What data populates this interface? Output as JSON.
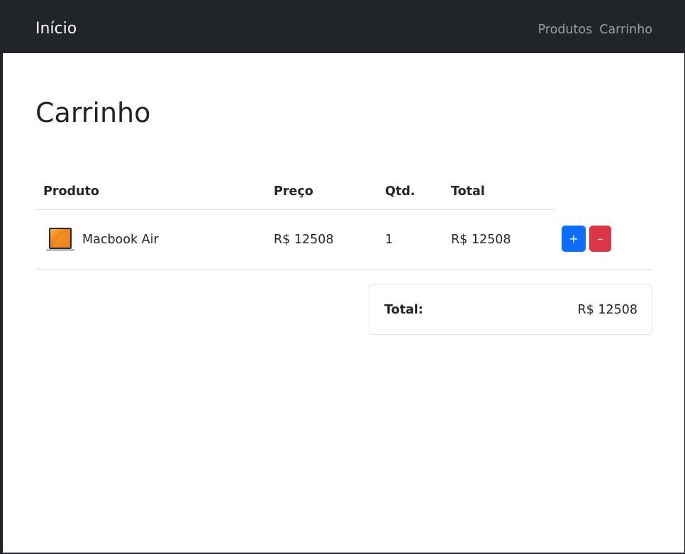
{
  "navbar": {
    "brand": "Início",
    "links": [
      {
        "label": "Produtos"
      },
      {
        "label": "Carrinho"
      }
    ]
  },
  "page": {
    "title": "Carrinho"
  },
  "cart": {
    "columns": [
      "Produto",
      "Preço",
      "Qtd.",
      "Total"
    ],
    "rows": [
      {
        "product": "Macbook Air",
        "price": "R$ 12508",
        "quantity": "1",
        "total": "R$ 12508",
        "increment_label": "+",
        "decrement_label": "–"
      }
    ]
  },
  "summary": {
    "label": "Total:",
    "value": "R$ 12508"
  },
  "colors": {
    "navbar": "#212529",
    "primary": "#0d6efd",
    "danger": "#dc3545"
  }
}
